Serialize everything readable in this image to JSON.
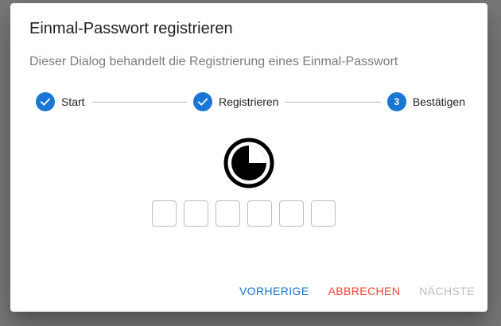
{
  "dialog": {
    "title": "Einmal-Passwort registrieren",
    "description": "Dieser Dialog behandelt die Registrierung eines Einmal-Passwort"
  },
  "stepper": {
    "steps": [
      {
        "label": "Start",
        "state": "completed",
        "icon": "check-icon"
      },
      {
        "label": "Registrieren",
        "state": "completed",
        "icon": "check-icon"
      },
      {
        "label": "Bestätigen",
        "state": "active",
        "number": "3"
      }
    ]
  },
  "timer": {
    "icon": "timer-icon"
  },
  "otp": {
    "box_count": 6,
    "values": [
      "",
      "",
      "",
      "",
      "",
      ""
    ]
  },
  "actions": {
    "prev_label": "VORHERIGE",
    "cancel_label": "ABBRECHEN",
    "next_label": "NÄCHSTE"
  },
  "colors": {
    "primary": "#1976d2",
    "danger": "#f44336",
    "disabled": "#bdbdbd",
    "overlay": "#7a7a7a"
  }
}
